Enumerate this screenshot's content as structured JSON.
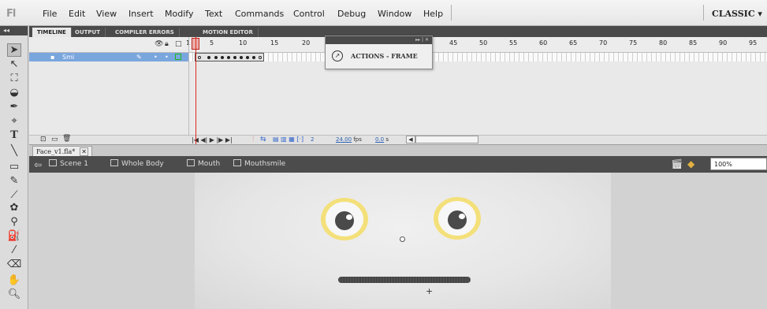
{
  "app": {
    "logo_text": "Fl",
    "workspace": "CLASSIC"
  },
  "menu": [
    "File",
    "Edit",
    "View",
    "Insert",
    "Modify",
    "Text",
    "Commands",
    "Control",
    "Debug",
    "Window",
    "Help"
  ],
  "timeline": {
    "tabs": [
      "TIMELINE",
      "OUTPUT",
      "COMPILER ERRORS",
      "MOTION EDITOR"
    ],
    "ruler": [
      "1",
      "5",
      "10",
      "15",
      "20",
      "45",
      "50",
      "55",
      "60",
      "65",
      "70",
      "75",
      "80",
      "85",
      "90",
      "95"
    ],
    "layer_name": "Smi",
    "current_frame": "2",
    "fps": "24.00",
    "fps_unit": "fps",
    "time": "0.0",
    "time_unit": "s"
  },
  "actions_panel": {
    "title": "ACTIONS - FRAME"
  },
  "document": {
    "tab_name": "Face_v1.fla*",
    "breadcrumbs": [
      "Scene 1",
      "Whole Body",
      "Mouth",
      "Mouthsmile"
    ],
    "zoom": "100%"
  },
  "colors": {
    "layer_selected": "#7aa6de",
    "playhead": "#e0271e",
    "eye_ring": "#f4e07a",
    "panel_dark": "#4a4a4a"
  },
  "icons": {
    "tools": [
      "selection-arrow",
      "subselection",
      "free-transform",
      "lasso",
      "pen",
      "text",
      "line",
      "rectangle",
      "pencil",
      "brush",
      "deco",
      "bone",
      "paint-bucket",
      "eyedropper",
      "eraser",
      "hand",
      "zoom"
    ]
  }
}
